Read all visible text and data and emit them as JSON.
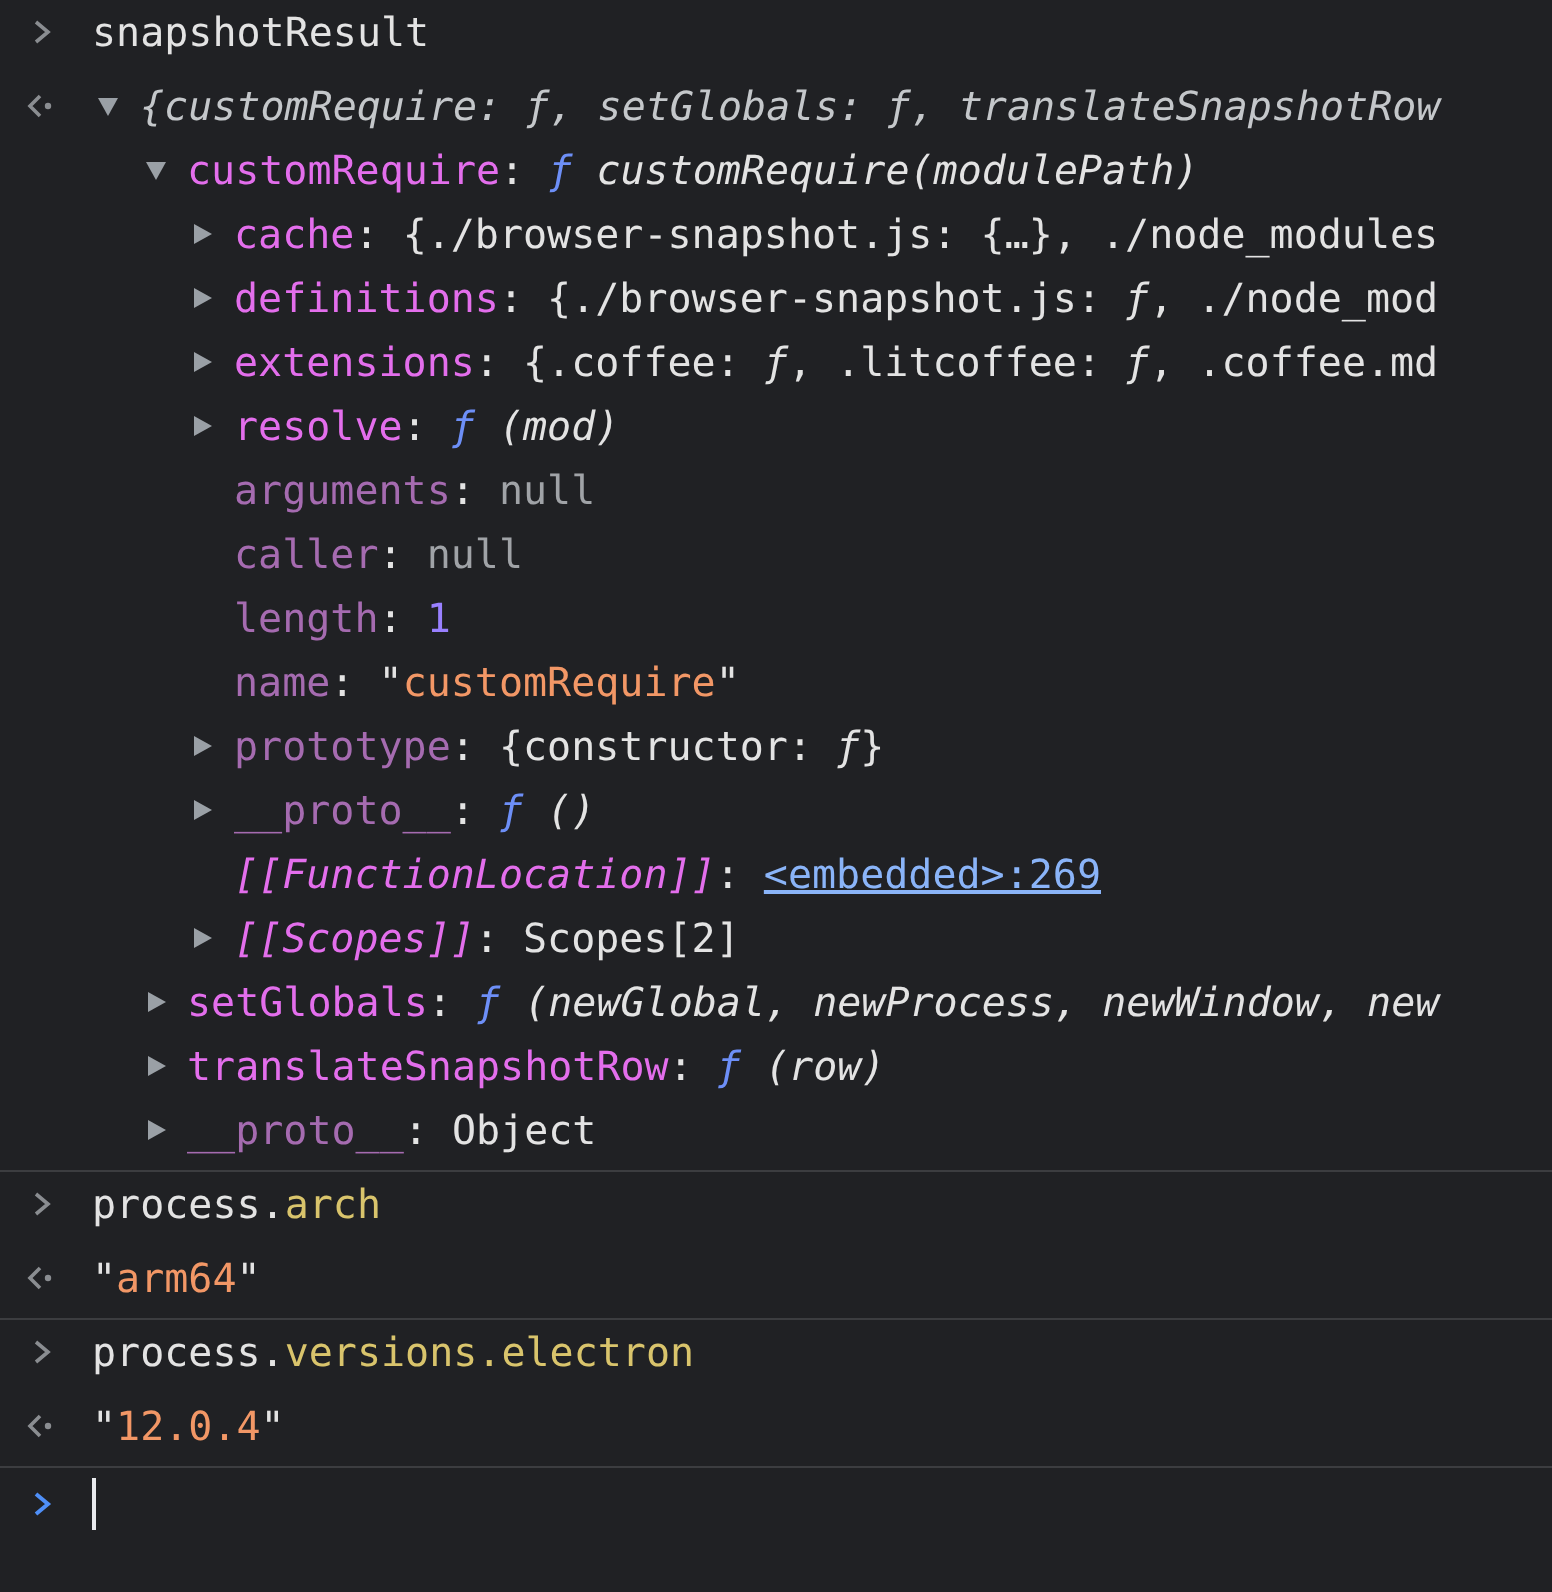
{
  "console": {
    "entries": [
      {
        "kind": "input",
        "tokens": [
          {
            "kind": "text",
            "text": "snapshotResult"
          }
        ]
      },
      {
        "kind": "output",
        "node": {
          "kind": "branch",
          "expanded": true,
          "tokens": [
            {
              "kind": "preview",
              "text": "{customRequire: ƒ, setGlobals: ƒ, translateSnapshotRow"
            }
          ],
          "children": [
            {
              "kind": "branch",
              "expanded": true,
              "tokens": [
                {
                  "kind": "key",
                  "text": "customRequire"
                },
                {
                  "kind": "punct",
                  "text": ": "
                },
                {
                  "kind": "func",
                  "text": "ƒ"
                },
                {
                  "kind": "italic",
                  "text": " customRequire(modulePath)"
                }
              ],
              "children": [
                {
                  "kind": "branch",
                  "expanded": false,
                  "tokens": [
                    {
                      "kind": "key",
                      "text": "cache"
                    },
                    {
                      "kind": "punct",
                      "text": ": "
                    },
                    {
                      "kind": "text",
                      "text": "{./browser-snapshot.js: {…}, ./node_modules"
                    }
                  ]
                },
                {
                  "kind": "branch",
                  "expanded": false,
                  "tokens": [
                    {
                      "kind": "key",
                      "text": "definitions"
                    },
                    {
                      "kind": "punct",
                      "text": ": "
                    },
                    {
                      "kind": "text",
                      "text": "{./browser-snapshot.js: "
                    },
                    {
                      "kind": "italic",
                      "text": "ƒ"
                    },
                    {
                      "kind": "text",
                      "text": ", ./node_mod"
                    }
                  ]
                },
                {
                  "kind": "branch",
                  "expanded": false,
                  "tokens": [
                    {
                      "kind": "key",
                      "text": "extensions"
                    },
                    {
                      "kind": "punct",
                      "text": ": "
                    },
                    {
                      "kind": "text",
                      "text": "{.coffee: "
                    },
                    {
                      "kind": "italic",
                      "text": "ƒ"
                    },
                    {
                      "kind": "text",
                      "text": ", .litcoffee: "
                    },
                    {
                      "kind": "italic",
                      "text": "ƒ"
                    },
                    {
                      "kind": "text",
                      "text": ", .coffee.md"
                    }
                  ]
                },
                {
                  "kind": "branch",
                  "expanded": false,
                  "tokens": [
                    {
                      "kind": "key",
                      "text": "resolve"
                    },
                    {
                      "kind": "punct",
                      "text": ": "
                    },
                    {
                      "kind": "func",
                      "text": "ƒ"
                    },
                    {
                      "kind": "italic",
                      "text": " (mod)"
                    }
                  ]
                },
                {
                  "kind": "leaf",
                  "tokens": [
                    {
                      "kind": "keydim",
                      "text": "arguments"
                    },
                    {
                      "kind": "punct",
                      "text": ": "
                    },
                    {
                      "kind": "null",
                      "text": "null"
                    }
                  ]
                },
                {
                  "kind": "leaf",
                  "tokens": [
                    {
                      "kind": "keydim",
                      "text": "caller"
                    },
                    {
                      "kind": "punct",
                      "text": ": "
                    },
                    {
                      "kind": "null",
                      "text": "null"
                    }
                  ]
                },
                {
                  "kind": "leaf",
                  "tokens": [
                    {
                      "kind": "keydim",
                      "text": "length"
                    },
                    {
                      "kind": "punct",
                      "text": ": "
                    },
                    {
                      "kind": "number",
                      "text": "1"
                    }
                  ]
                },
                {
                  "kind": "leaf",
                  "tokens": [
                    {
                      "kind": "keydim",
                      "text": "name"
                    },
                    {
                      "kind": "punct",
                      "text": ": "
                    },
                    {
                      "kind": "text",
                      "text": "\""
                    },
                    {
                      "kind": "string",
                      "text": "customRequire"
                    },
                    {
                      "kind": "text",
                      "text": "\""
                    }
                  ]
                },
                {
                  "kind": "branch",
                  "expanded": false,
                  "tokens": [
                    {
                      "kind": "keydim",
                      "text": "prototype"
                    },
                    {
                      "kind": "punct",
                      "text": ": "
                    },
                    {
                      "kind": "text",
                      "text": "{constructor: "
                    },
                    {
                      "kind": "italic",
                      "text": "ƒ"
                    },
                    {
                      "kind": "text",
                      "text": "}"
                    }
                  ]
                },
                {
                  "kind": "branch",
                  "expanded": false,
                  "tokens": [
                    {
                      "kind": "keydim",
                      "text": "__proto__"
                    },
                    {
                      "kind": "punct",
                      "text": ": "
                    },
                    {
                      "kind": "func",
                      "text": "ƒ"
                    },
                    {
                      "kind": "italic",
                      "text": " ()"
                    }
                  ]
                },
                {
                  "kind": "leaf",
                  "tokens": [
                    {
                      "kind": "internal",
                      "text": "[[FunctionLocation]]"
                    },
                    {
                      "kind": "punct",
                      "text": ": "
                    },
                    {
                      "kind": "link",
                      "text": "<embedded>:269"
                    }
                  ]
                },
                {
                  "kind": "branch",
                  "expanded": false,
                  "tokens": [
                    {
                      "kind": "internal",
                      "text": "[[Scopes]]"
                    },
                    {
                      "kind": "punct",
                      "text": ": "
                    },
                    {
                      "kind": "text",
                      "text": "Scopes[2]"
                    }
                  ]
                }
              ]
            },
            {
              "kind": "branch",
              "expanded": false,
              "tokens": [
                {
                  "kind": "key",
                  "text": "setGlobals"
                },
                {
                  "kind": "punct",
                  "text": ": "
                },
                {
                  "kind": "func",
                  "text": "ƒ"
                },
                {
                  "kind": "italic",
                  "text": " (newGlobal, newProcess, newWindow, new"
                }
              ]
            },
            {
              "kind": "branch",
              "expanded": false,
              "tokens": [
                {
                  "kind": "key",
                  "text": "translateSnapshotRow"
                },
                {
                  "kind": "punct",
                  "text": ": "
                },
                {
                  "kind": "func",
                  "text": "ƒ"
                },
                {
                  "kind": "italic",
                  "text": " (row)"
                }
              ]
            },
            {
              "kind": "branch",
              "expanded": false,
              "tokens": [
                {
                  "kind": "keydim",
                  "text": "__proto__"
                },
                {
                  "kind": "punct",
                  "text": ": "
                },
                {
                  "kind": "text",
                  "text": "Object"
                }
              ]
            }
          ]
        }
      },
      {
        "kind": "input",
        "tokens": [
          {
            "kind": "text",
            "text": "process."
          },
          {
            "kind": "prop",
            "text": "arch"
          }
        ]
      },
      {
        "kind": "output",
        "node": {
          "kind": "leaf",
          "tokens": [
            {
              "kind": "text",
              "text": "\""
            },
            {
              "kind": "string",
              "text": "arm64"
            },
            {
              "kind": "text",
              "text": "\""
            }
          ]
        }
      },
      {
        "kind": "input",
        "tokens": [
          {
            "kind": "text",
            "text": "process."
          },
          {
            "kind": "prop",
            "text": "versions.electron"
          }
        ]
      },
      {
        "kind": "output",
        "node": {
          "kind": "leaf",
          "tokens": [
            {
              "kind": "text",
              "text": "\""
            },
            {
              "kind": "string",
              "text": "12.0.4"
            },
            {
              "kind": "text",
              "text": "\""
            }
          ]
        }
      },
      {
        "kind": "prompt"
      }
    ]
  }
}
